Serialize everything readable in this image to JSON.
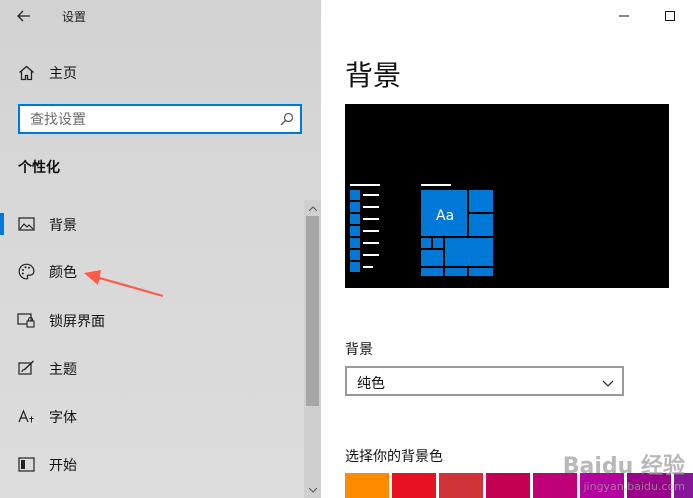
{
  "app": {
    "title": "设置"
  },
  "sidebar": {
    "home_label": "主页",
    "search_placeholder": "查找设置",
    "section_title": "个性化",
    "items": [
      {
        "label": "背景",
        "icon": "image-icon",
        "active": true
      },
      {
        "label": "颜色",
        "icon": "palette-icon",
        "active": false
      },
      {
        "label": "锁屏界面",
        "icon": "lock-screen-icon",
        "active": false
      },
      {
        "label": "主题",
        "icon": "theme-brush-icon",
        "active": false
      },
      {
        "label": "字体",
        "icon": "font-icon",
        "active": false
      },
      {
        "label": "开始",
        "icon": "start-menu-icon",
        "active": false
      }
    ]
  },
  "main": {
    "heading": "背景",
    "preview_tile_text": "Aa",
    "background_label": "背景",
    "background_select_value": "纯色",
    "choose_color_label": "选择你的背景色",
    "swatch_colors": [
      "#ff8c00",
      "#e81123",
      "#d13438",
      "#c30052",
      "#bf0077",
      "#b4009e",
      "#9a0089",
      "#881798"
    ]
  },
  "watermark": {
    "text": "Baidu 经验",
    "url": "jingyan.baidu.com"
  },
  "colors": {
    "accent": "#0078d7",
    "arrow": "#ff5a4a"
  }
}
